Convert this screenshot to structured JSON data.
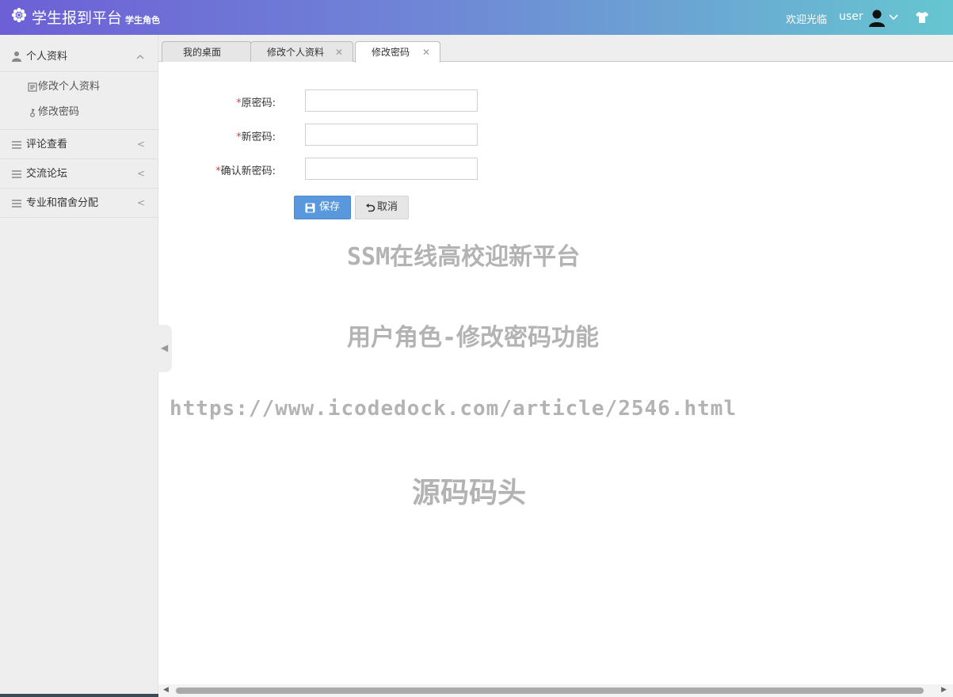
{
  "header": {
    "title": "学生报到平台",
    "subtitle": "学生角色",
    "welcome": "欢迎光临",
    "username": "user",
    "logo_icon": "gear-flower-icon",
    "user_icon": "user-icon",
    "skin_icon": "tshirt-icon"
  },
  "sidebar": {
    "groups": [
      {
        "label": "个人资料",
        "icon": "user-icon",
        "expanded": true,
        "items": [
          {
            "label": "修改个人资料",
            "icon": "edit-icon"
          },
          {
            "label": "修改密码",
            "icon": "key-icon"
          }
        ]
      },
      {
        "label": "评论查看",
        "icon": "list-icon",
        "arrow": "<"
      },
      {
        "label": "交流论坛",
        "icon": "list-icon",
        "arrow": "<"
      },
      {
        "label": "专业和宿舍分配",
        "icon": "list-icon",
        "arrow": "<"
      }
    ]
  },
  "tabs": [
    {
      "label": "我的桌面",
      "closable": false
    },
    {
      "label": "修改个人资料",
      "closable": true
    },
    {
      "label": "修改密码",
      "closable": true,
      "active": true
    }
  ],
  "form": {
    "required_mark": "*",
    "old_password_label": "原密码:",
    "new_password_label": "新密码:",
    "confirm_password_label": "确认新密码:",
    "save_label": "保存",
    "cancel_label": "取消"
  },
  "watermark": {
    "line1": "SSM在线高校迎新平台",
    "line2": "用户角色-修改密码功能",
    "line3": "https://www.icodedock.com/article/2546.html",
    "line4": "源码码头"
  },
  "colors": {
    "header_start": "#6d5fd6",
    "header_end": "#66c6d0",
    "primary_button": "#5a98de",
    "required": "#e4393c"
  }
}
